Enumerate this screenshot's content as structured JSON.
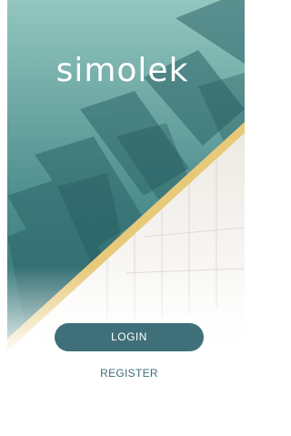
{
  "app": {
    "logo_text": "simolek"
  },
  "actions": {
    "login_label": "LOGIN",
    "register_label": "REGISTER"
  },
  "colors": {
    "teal_top": "#93c6bf",
    "teal_bottom": "#2f6f74",
    "gold_stripe": "#e7c97a",
    "button": "#3f7079",
    "link": "#3f7079"
  }
}
